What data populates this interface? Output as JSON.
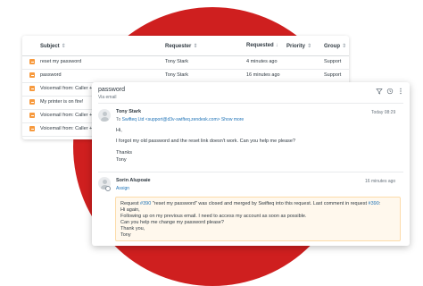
{
  "table": {
    "headers": {
      "subject": "Subject",
      "requester": "Requester",
      "requested": "Requested",
      "priority": "Priority",
      "group": "Group"
    },
    "rows": [
      {
        "subject": "reset my password",
        "requester": "Tony Stark",
        "requested": "4 minutes ago",
        "group": "Support"
      },
      {
        "subject": "password",
        "requester": "Tony Stark",
        "requested": "16 minutes ago",
        "group": "Support"
      },
      {
        "subject": "Voicemail from: Caller +1",
        "requester": "",
        "requested": "",
        "group": ""
      },
      {
        "subject": "My printer is on fire!",
        "requester": "",
        "requested": "",
        "group": ""
      },
      {
        "subject": "Voicemail from: Caller +1",
        "requester": "",
        "requested": "",
        "group": ""
      },
      {
        "subject": "Voicemail from: Caller +1",
        "requester": "",
        "requested": "",
        "group": ""
      }
    ]
  },
  "ticket": {
    "title": "password",
    "via": "Via email",
    "first": {
      "author": "Tony Stark",
      "time": "Today 08:29",
      "to_prefix": "To",
      "to": "Swifteq Ltd <support@d3v-swifteq.zendesk.com>",
      "show_more": "Show more",
      "lines": [
        "Hi,",
        "I forgot my old password and the reset link doesn't work. Can you help me please?",
        "Thanks",
        "Tony"
      ]
    },
    "second": {
      "author": "Sorin Alupoaie",
      "action": "Assign",
      "time": "16 minutes ago",
      "note_line1_a": "Request ",
      "note_line1_link1": "#390",
      "note_line1_b": " \"reset my password\" was closed and merged by Swifteq into this request. Last comment in request ",
      "note_line1_link2": "#390",
      "note_line1_c": ":",
      "note_lines": [
        "Hi again,",
        "Following up on my previous email. I need to access my account as soon as possible.",
        "Can you help me change my password please?",
        "Thank you,",
        "Tony"
      ]
    }
  },
  "colors": {
    "accent_circle": "#cf1f1f",
    "checkbox_orange": "#f79a3e",
    "link_blue": "#1f73b7",
    "note_bg": "#fff8ed"
  },
  "icons": [
    "filter-icon",
    "history-icon",
    "more-vertical-icon",
    "sort-icon"
  ]
}
